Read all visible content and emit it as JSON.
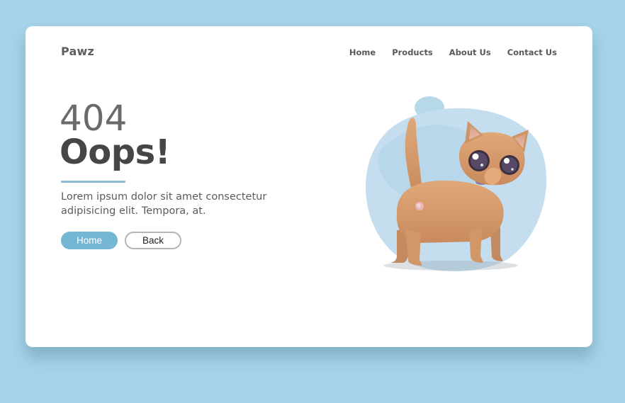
{
  "brand": {
    "name": "Pawz"
  },
  "nav": {
    "items": [
      {
        "label": "Home"
      },
      {
        "label": "Products"
      },
      {
        "label": "About Us"
      },
      {
        "label": "Contact Us"
      }
    ]
  },
  "error": {
    "code": "404",
    "headline": "Oops!",
    "description": "Lorem ipsum dolor sit amet consectetur adipisicing elit. Tempora, at."
  },
  "actions": {
    "home_label": "Home",
    "back_label": "Back"
  },
  "illustration": {
    "subject": "kitten-illustration"
  },
  "colors": {
    "page_background": "#a6d3e8",
    "card_background": "#ffffff",
    "accent": "#74b6d4",
    "blob": "#bfdcec"
  }
}
